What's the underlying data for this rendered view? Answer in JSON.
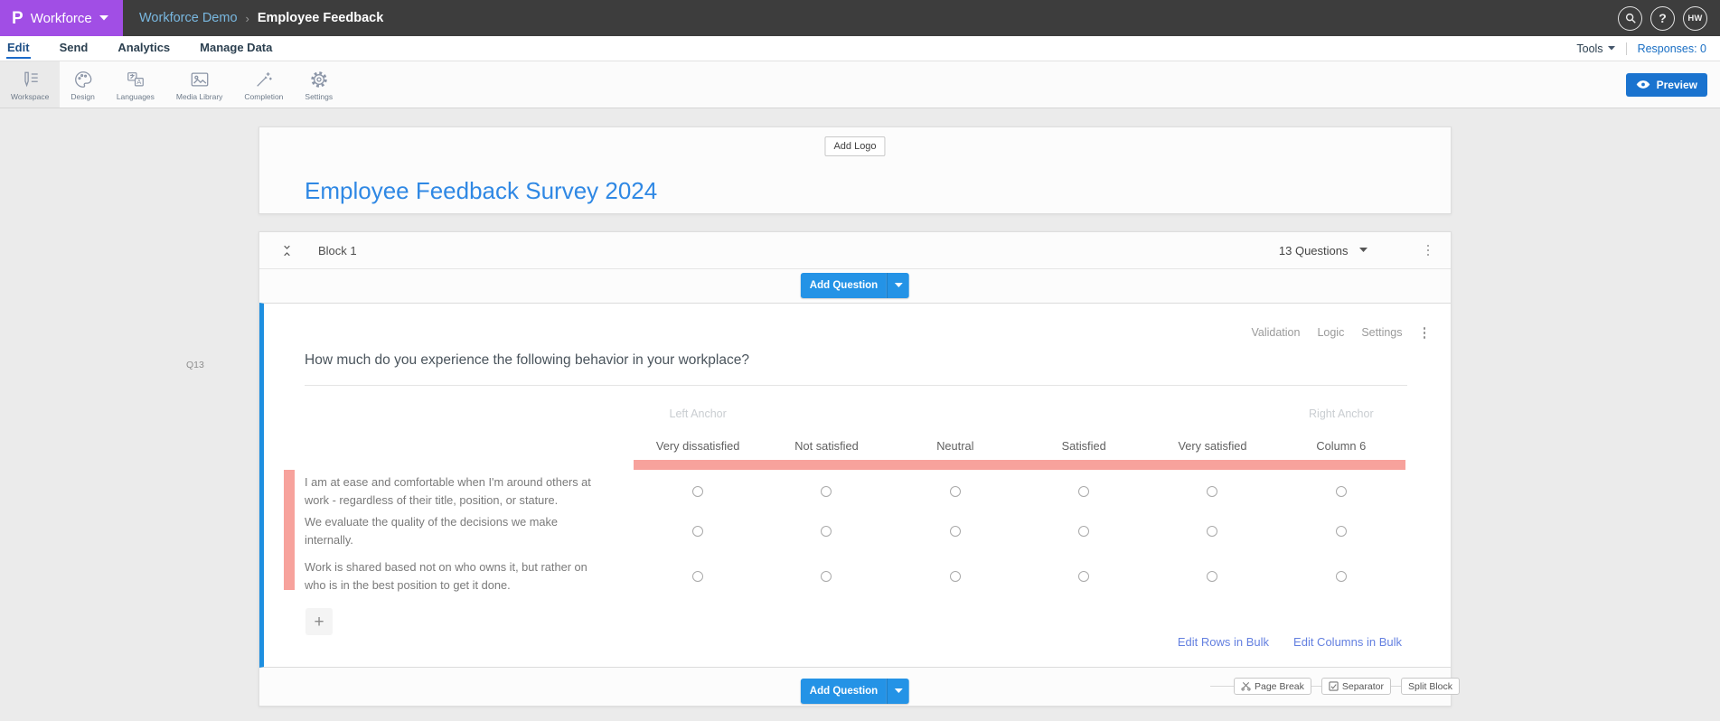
{
  "colors": {
    "accent_purple": "#a14ee5",
    "topbar_bg": "#3d3d3d",
    "breadcrumb_link": "#79b8e0",
    "primary_blue": "#2493e6",
    "preview_blue": "#1a73cf",
    "title_blue": "#2f88e4",
    "selection_blue": "#1e8fe0",
    "pink_highlight": "#f7a29c",
    "link_blue": "#6480e0",
    "responses_blue": "#1a6fc4"
  },
  "topbar": {
    "logo_letter": "P",
    "product_name": "Workforce",
    "breadcrumb": {
      "project": "Workforce Demo",
      "separator": "›",
      "page": "Employee Feedback"
    },
    "help_label": "?",
    "avatar_initials": "HW"
  },
  "nav": {
    "items": [
      {
        "label": "Edit",
        "active": true
      },
      {
        "label": "Send",
        "active": false
      },
      {
        "label": "Analytics",
        "active": false
      },
      {
        "label": "Manage Data",
        "active": false
      }
    ],
    "tools_label": "Tools",
    "responses_label": "Responses: 0"
  },
  "toolbar": {
    "tabs": [
      {
        "label": "Workspace",
        "icon": "workspace-icon",
        "active": true
      },
      {
        "label": "Design",
        "icon": "design-icon",
        "active": false
      },
      {
        "label": "Languages",
        "icon": "languages-icon",
        "active": false
      },
      {
        "label": "Media Library",
        "icon": "media-library-icon",
        "active": false
      },
      {
        "label": "Completion",
        "icon": "completion-icon",
        "active": false
      },
      {
        "label": "Settings",
        "icon": "settings-icon",
        "active": false
      }
    ],
    "preview_label": "Preview"
  },
  "survey": {
    "add_logo_label": "Add Logo",
    "title": "Employee Feedback Survey 2024"
  },
  "block": {
    "name": "Block 1",
    "question_count_label": "13 Questions",
    "add_question_label": "Add Question"
  },
  "question": {
    "id_label": "Q13",
    "menu": [
      "Validation",
      "Logic",
      "Settings"
    ],
    "text": "How much do you experience the following behavior in your workplace?",
    "left_anchor_label": "Left Anchor",
    "right_anchor_label": "Right Anchor",
    "columns": [
      "Very dissatisfied",
      "Not satisfied",
      "Neutral",
      "Satisfied",
      "Very satisfied",
      "Column 6"
    ],
    "rows": [
      "I am at ease and comfortable when I'm around others at work - regardless of their title, position, or stature.",
      "We evaluate the quality of the decisions we make internally.",
      "Work is shared based not on who owns it, but rather on who is in the best position to get it done."
    ],
    "add_row_label": "+",
    "edit_rows_label": "Edit Rows in Bulk",
    "edit_columns_label": "Edit Columns in Bulk"
  },
  "footer_actions": {
    "buttons": [
      {
        "label": "Page Break",
        "icon": "page-break-icon"
      },
      {
        "label": "Separator",
        "icon": "separator-icon"
      },
      {
        "label": "Split Block",
        "icon": null
      }
    ]
  }
}
